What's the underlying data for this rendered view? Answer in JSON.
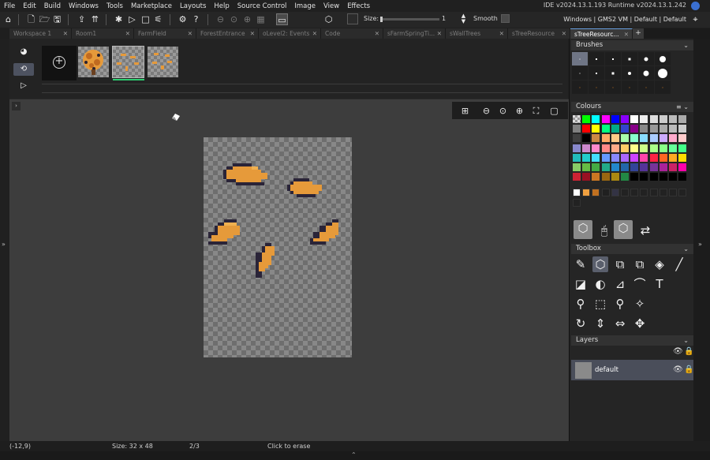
{
  "menubar": {
    "items": [
      "File",
      "Edit",
      "Build",
      "Windows",
      "Tools",
      "Marketplace",
      "Layouts",
      "Help",
      "Source Control",
      "Image",
      "View",
      "Effects"
    ],
    "version": "IDE v2024.13.1.193  Runtime v2024.13.1.242"
  },
  "toolbar": {
    "size_label": "Size:",
    "size_value": "1",
    "smooth_label": "Smooth",
    "target": "Windows | GMS2 VM | Default | Default"
  },
  "tabs": [
    {
      "label": "Workspace 1",
      "active": false
    },
    {
      "label": "Room1",
      "active": false
    },
    {
      "label": "FarmField",
      "active": false
    },
    {
      "label": "ForestEntrance",
      "active": false
    },
    {
      "label": "oLevel2: Events",
      "active": false
    },
    {
      "label": "Code",
      "active": false
    },
    {
      "label": "sFarmSpringTi...",
      "active": false
    },
    {
      "label": "sWallTrees",
      "active": false
    },
    {
      "label": "sTreeResource",
      "active": false
    },
    {
      "label": "sTreeResourc...",
      "active": true
    }
  ],
  "panels": {
    "brushes": "Brushes",
    "colours": "Colours",
    "toolbox": "Toolbox",
    "layers": "Layers"
  },
  "layers": [
    {
      "name": "default"
    }
  ],
  "colours": {
    "rows": [
      [
        "checker",
        "#00ff00",
        "#00ffff",
        "#ff00ff",
        "#0000ff",
        "#8800ff",
        "#ffffff",
        "#eeeeee",
        "#dddddd",
        "#cccccc",
        "#bbbbbb",
        "#aaaaaa"
      ],
      [
        "#808080",
        "#ff0000",
        "#ffff00",
        "#00ff80",
        "#00aa88",
        "#3344cc",
        "#880088",
        "#888888",
        "#999999",
        "#aaaaaa",
        "#bbbbbb",
        "#cccccc"
      ],
      [
        "#404040",
        "#000000",
        "#cc8844",
        "#ffaa66",
        "#ffcc88",
        "#aaffaa",
        "#88ffcc",
        "#88ddff",
        "#aaccff",
        "#ccaaff",
        "#ffaacc",
        "#ffcccc"
      ],
      [
        "#8888cc",
        "#cc88cc",
        "#ff88cc",
        "#ff8888",
        "#ffaa88",
        "#ffcc66",
        "#ffff88",
        "#ccff88",
        "#aaff88",
        "#88ff88",
        "#66ff99",
        "#44ff88"
      ],
      [
        "#22bbbb",
        "#22cccc",
        "#44ddff",
        "#6699ff",
        "#8888ff",
        "#aa66ff",
        "#cc44ff",
        "#ff44aa",
        "#ff2244",
        "#ff6622",
        "#ffaa22",
        "#ffdd00"
      ],
      [
        "#88cc66",
        "#66bb44",
        "#44aa44",
        "#22aa88",
        "#2288cc",
        "#2266aa",
        "#334499",
        "#553399",
        "#773399",
        "#aa2299",
        "#cc2266",
        "#ff00aa"
      ],
      [
        "#cc2233",
        "#991122",
        "#cc7722",
        "#996611",
        "#aa8811",
        "#228844",
        "#000000",
        "#000000",
        "#000000",
        "#000000",
        "#000000",
        "#000000"
      ]
    ],
    "custom": [
      "#ffffff",
      "#f0a040",
      "#c07020",
      "#202020",
      "#333344",
      "#222222",
      "#222222",
      "#222222",
      "#222222",
      "#222222",
      "#222222",
      "#222222"
    ]
  },
  "status": {
    "coords": "(-12,9)",
    "size": "Size: 32 x 48",
    "frame": "2/3",
    "hint": "Click to erase"
  }
}
